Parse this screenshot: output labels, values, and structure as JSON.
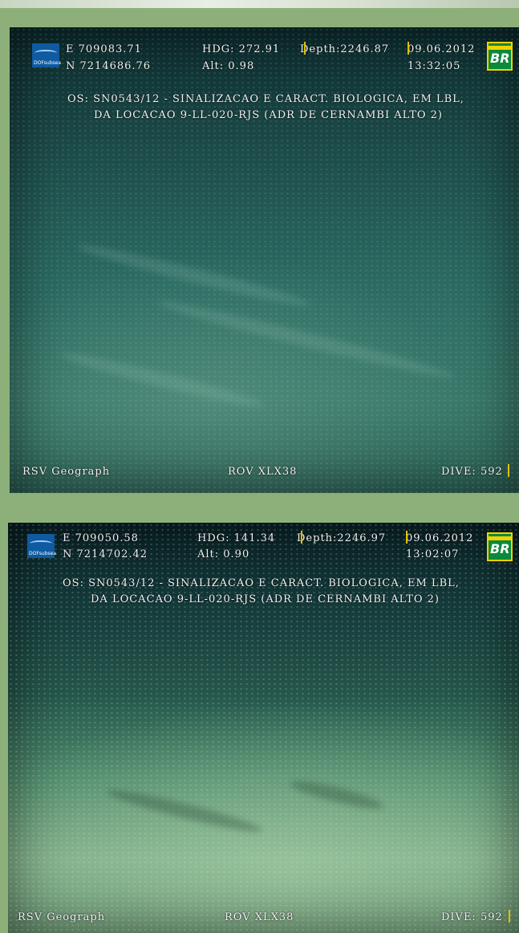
{
  "frames": [
    {
      "easting": "E  709083.71",
      "northing": "N  7214686.76",
      "heading": "HDG: 272.91",
      "altitude": "Alt: 0.98",
      "depth": "Depth:2246.87",
      "date": "09.06.2012",
      "time": "13:32:05",
      "os_line1": "OS: SN0543/12 - SINALIZACAO E CARACT. BIOLOGICA, EM LBL,",
      "os_line2": "DA LOCACAO 9-LL-020-RJS (ADR DE CERNAMBI ALTO 2)",
      "vessel": "RSV  Geograph",
      "rov": "ROV XLX38",
      "dive": "DIVE: 592"
    },
    {
      "easting": "E  709050.58",
      "northing": "N  7214702.42",
      "heading": "HDG: 141.34",
      "altitude": "Alt: 0.90",
      "depth": "Depth:2246.97",
      "date": "09.06.2012",
      "time": "13:02:07",
      "os_line1": "OS: SN0543/12 - SINALIZACAO E CARACT. BIOLOGICA, EM LBL,",
      "os_line2": "DA LOCACAO 9-LL-020-RJS (ADR DE CERNAMBI ALTO 2)",
      "vessel": "RSV  Geograph",
      "rov": "ROV XLX38",
      "dive": "DIVE: 592"
    }
  ],
  "logos": {
    "left_logo": "DOFsubsea",
    "right_logo": "BR",
    "left_logo_color": "#0f5aa0",
    "right_logo_color": "#0a8a3a",
    "right_logo_accent": "#f5d000"
  }
}
